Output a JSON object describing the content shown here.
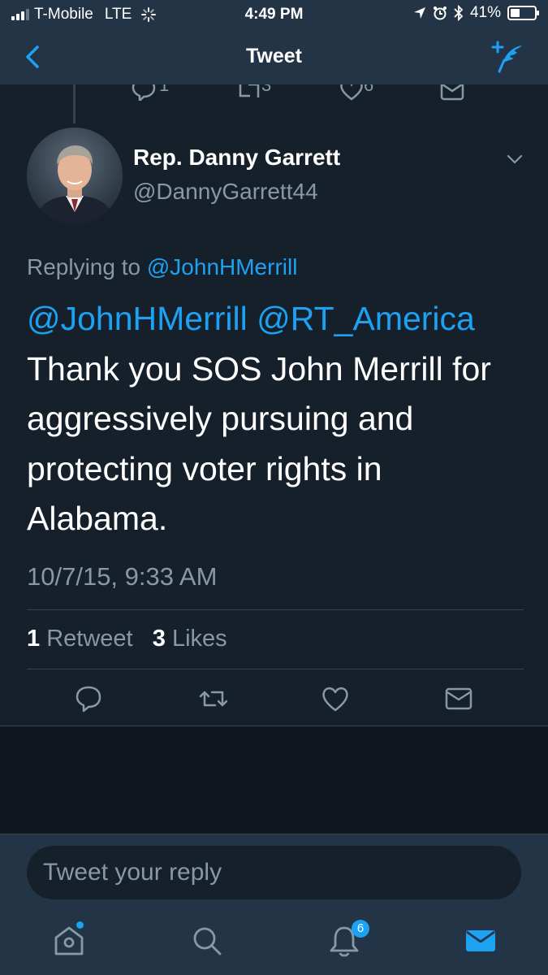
{
  "status_bar": {
    "carrier": "T-Mobile",
    "network": "LTE",
    "time": "4:49 PM",
    "battery_percent": "41%",
    "battery_level": 0.41
  },
  "nav": {
    "title": "Tweet",
    "back_icon": "chevron-left-icon",
    "compose_icon": "compose-tweet-icon"
  },
  "previous_tweet_counts": {
    "replies": "1",
    "retweets": "3",
    "likes": "6"
  },
  "tweet": {
    "display_name": "Rep. Danny Garrett",
    "handle": "@DannyGarrett44",
    "replying_prefix": "Replying to",
    "replying_to": "@JohnHMerrill",
    "mention_1": "@JohnHMerrill",
    "mention_2": "@RT_America",
    "text": "Thank you SOS John Merrill for aggressively pursuing and protecting voter rights in Alabama.",
    "timestamp": "10/7/15, 9:33 AM",
    "retweet_count": "1",
    "retweet_label": "Retweet",
    "like_count": "3",
    "like_label": "Likes"
  },
  "reply": {
    "placeholder": "Tweet your reply"
  },
  "tabbar": {
    "notifications_badge": "6",
    "items": [
      "home-icon",
      "search-icon",
      "notifications-icon",
      "messages-icon"
    ]
  },
  "colors": {
    "background": "#15202b",
    "bar": "#243447",
    "accent": "#1da1f2",
    "secondary_text": "#8899a6",
    "divider": "#38444d"
  }
}
